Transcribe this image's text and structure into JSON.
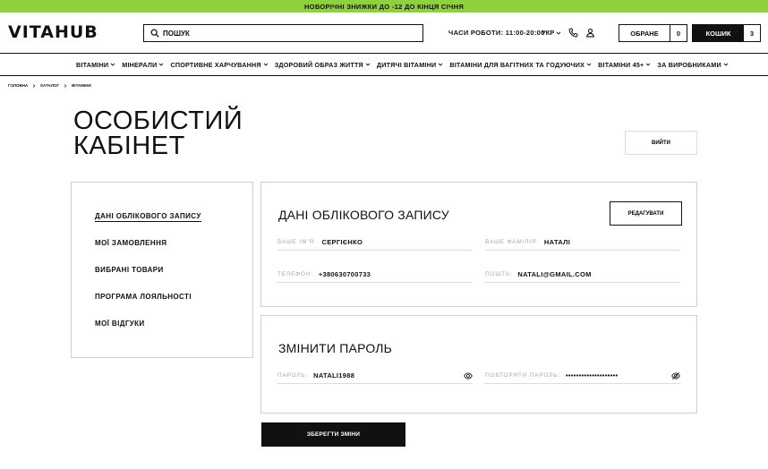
{
  "promo": "НОВОРІЧНІ ЗНИЖКИ ДО -12 ДО КІНЦЯ СІЧНЯ",
  "header": {
    "logo": "VITAHUB",
    "logo_accent_color": "#8fd13c",
    "search_placeholder": "ПОШУК",
    "hours": "ЧАСИ РОБОТИ: 11:00-20:00",
    "language": "УКР",
    "favorites_label": "ОБРАНЕ",
    "favorites_count": "0",
    "cart_label": "КОШИК",
    "cart_count": "3"
  },
  "nav": [
    "ВІТАМІНИ",
    "МІНЕРАЛИ",
    "СПОРТИВНЕ ХАРЧУВАННЯ",
    "ЗДОРОВИЙ ОБРАЗ ЖИТТЯ",
    "ДИТЯЧІ ВІТАМІНИ",
    "ВІТАМІНИ ДЛЯ ВАГІТНИХ ТА ГОДУЮЧИХ",
    "ВІТАМІНИ 45+",
    "ЗА ВИРОБНИКАМИ"
  ],
  "breadcrumbs": [
    "ГОЛОВНА",
    "КАТАЛОГ",
    "ВІТАМІНИ"
  ],
  "page_title": "ОСОБИСТИЙ\nКАБІНЕТ",
  "logout_label": "ВИЙТИ",
  "sidebar": [
    "ДАНІ ОБЛІКОВОГО ЗАПИСУ",
    "МОЇ ЗАМОВЛЕННЯ",
    "ВИБРАНІ ТОВАРИ",
    "ПРОГРАМА ЛОЯЛЬНОСТІ",
    "МОЇ ВІДГУКИ"
  ],
  "account": {
    "title": "ДАНІ ОБЛІКОВОГО ЗАПИСУ",
    "edit_label": "РЕДАГУВАТИ",
    "first_name_label": "ВАШЕ ІМ'Я:",
    "first_name": "СЕРГІЄНКО",
    "last_name_label": "ВАШЕ ФАМІЛІЯ:",
    "last_name": "НАТАЛІ",
    "phone_label": "ТЕЛЕФОН:",
    "phone": "+380630700733",
    "email_label": "ПОШТА:",
    "email": "NATALI@GMAIL.COM"
  },
  "password": {
    "title": "ЗМІНИТИ ПАРОЛЬ",
    "password_label": "ПАРОЛЬ:",
    "password_value": "NATALI1988",
    "repeat_label": "ПОВТОРИТИ ПАРОЛЬ:",
    "repeat_value": "••••••••••••••••••••"
  },
  "save_label": "ЗБЕРЕГТИ ЗМІНИ"
}
